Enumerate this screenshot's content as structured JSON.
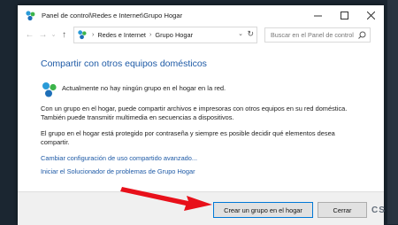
{
  "window": {
    "title": "Panel de control\\Redes e Internet\\Grupo Hogar"
  },
  "address": {
    "crumb1": "Redes e Internet",
    "crumb2": "Grupo Hogar",
    "search_placeholder": "Buscar en el Panel de control"
  },
  "content": {
    "heading": "Compartir con otros equipos domésticos",
    "notice": "Actualmente no hay ningún grupo en el hogar en la red.",
    "para1_line1": "Con un grupo en el hogar, puede compartir archivos e impresoras con otros equipos en su red doméstica.",
    "para1_line2": "También puede transmitir multimedia en secuencias a dispositivos.",
    "para2_line1": "El grupo en el hogar está protegido por contraseña y siempre es posible decidir qué elementos desea",
    "para2_line2": "compartir.",
    "link1": "Cambiar configuración de uso compartido avanzado...",
    "link2": "Iniciar el Solucionador de problemas de Grupo Hogar"
  },
  "footer": {
    "create_button": "Crear un grupo en el hogar",
    "close_button": "Cerrar"
  },
  "colors": {
    "link": "#1e5aa6",
    "arrow": "#e8101a",
    "primary_border": "#0078d7"
  },
  "icons": {
    "title": "homegroup-icon",
    "notice": "homegroup-icon"
  },
  "watermark": "CS"
}
